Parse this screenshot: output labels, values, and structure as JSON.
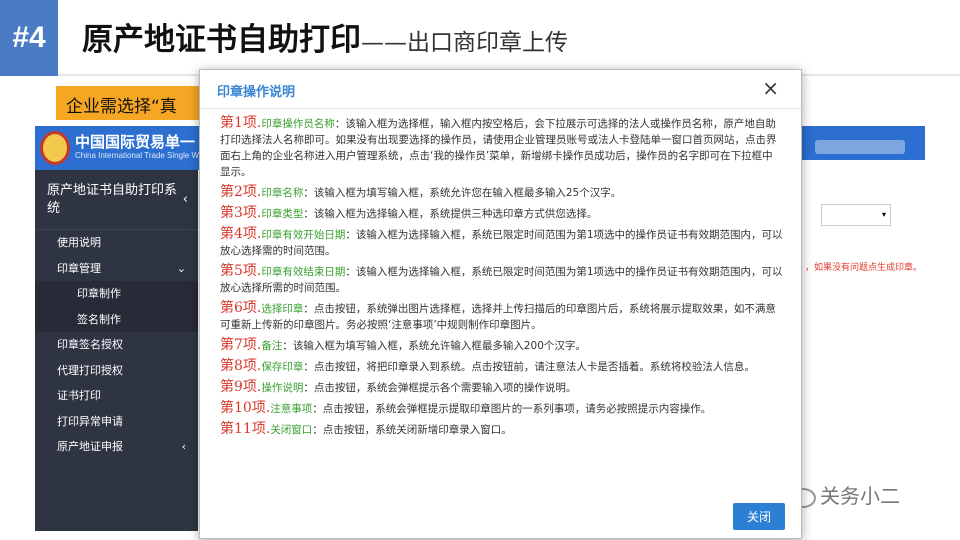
{
  "slide": {
    "badge": "#4",
    "title_main": "原产地证书自助打印",
    "title_sub": "——出口商印章上传",
    "orange_note": "企业需选择“真"
  },
  "background_app": {
    "logo_cn": "中国国际贸易单一",
    "logo_en": "China International Trade Single W",
    "sidebar_title": "原产地证书自助打印系统",
    "sidebar_items": [
      {
        "label": "使用说明",
        "sub": false,
        "arrow": ""
      },
      {
        "label": "印章管理",
        "sub": false,
        "arrow": "⌄"
      },
      {
        "label": "印章制作",
        "sub": true,
        "arrow": ""
      },
      {
        "label": "签名制作",
        "sub": true,
        "arrow": ""
      },
      {
        "label": "印章签名授权",
        "sub": false,
        "arrow": ""
      },
      {
        "label": "代理打印授权",
        "sub": false,
        "arrow": ""
      },
      {
        "label": "证书打印",
        "sub": false,
        "arrow": ""
      },
      {
        "label": "打印异常申请",
        "sub": false,
        "arrow": ""
      },
      {
        "label": "原产地证申报",
        "sub": false,
        "arrow": "‹"
      }
    ],
    "red_note": "，如果没有问题点生成印章。",
    "watermark": "关务小二"
  },
  "modal": {
    "title": "印章操作说明",
    "close_icon": "close-icon",
    "button_label": "关闭",
    "rules": [
      {
        "label": "第1项.",
        "term": "印章操作员名称",
        "text": "：该输入框为选择框，输入框内按空格后，会下拉展示可选择的法人或操作员名称，原产地自助打印选择法人名称即可。如果没有出现要选择的操作员，请使用企业管理员账号或法人卡登陆单一窗口首页网站，点击界面右上角的企业名称进入用户管理系统，点击‘我的操作员’菜单，新增绑卡操作员成功后，操作员的名字即可在下拉框中显示。"
      },
      {
        "label": "第2项.",
        "term": "印章名称",
        "text": "：该输入框为填写输入框，系统允许您在输入框最多输入25个汉字。"
      },
      {
        "label": "第3项.",
        "term": "印章类型",
        "text": "：该输入框为选择输入框，系统提供三种选印章方式供您选择。"
      },
      {
        "label": "第4项.",
        "term": "印章有效开始日期",
        "text": "：该输入框为选择输入框，系统已限定时间范围为第1项选中的操作员证书有效期范围内，可以放心选择需的时间范围。"
      },
      {
        "label": "第5项.",
        "term": "印章有效结束日期",
        "text": "：该输入框为选择输入框，系统已限定时间范围为第1项选中的操作员证书有效期范围内，可以放心选择所需的时间范围。"
      },
      {
        "label": "第6项.",
        "term": "选择印章",
        "text": "：点击按钮，系统弹出图片选择框，选择并上传扫描后的印章图片后，系统将展示提取效果，如不满意可重新上传新的印章图片。务必按照‘注意事项’中规则制作印章图片。"
      },
      {
        "label": "第7项.",
        "term": "备注",
        "text": "：该输入框为填写输入框，系统允许输入框最多输入200个汉字。"
      },
      {
        "label": "第8项.",
        "term": "保存印章",
        "text": "：点击按钮，将把印章录入到系统。点击按钮前，请注意法人卡是否插着。系统将校验法人信息。"
      },
      {
        "label": "第9项.",
        "term": "操作说明",
        "text": "：点击按钮，系统会弹框提示各个需要输入项的操作说明。"
      },
      {
        "label": "第10项.",
        "term": "注意事项",
        "text": "：点击按钮，系统会弹框提示提取印章图片的一系列事项，请务必按照提示内容操作。"
      },
      {
        "label": "第11项.",
        "term": "关闭窗口",
        "text": "：点击按钮，系统关闭新增印章录入窗口。"
      }
    ]
  }
}
